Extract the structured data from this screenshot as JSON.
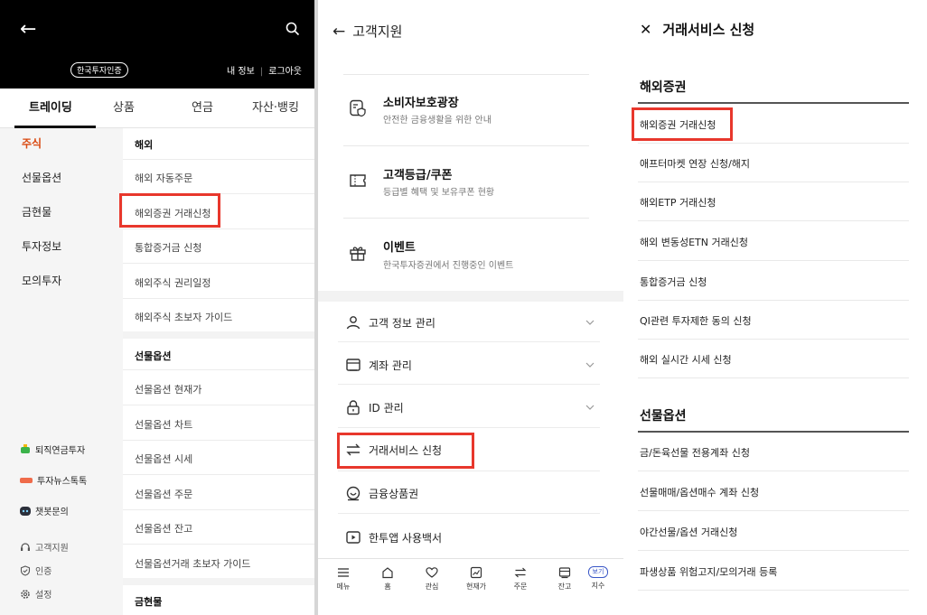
{
  "panel1": {
    "badge": "한국투자인증",
    "links": [
      "내 정보",
      "로그아웃"
    ],
    "tabs": [
      "트레이딩",
      "상품",
      "연금",
      "자산·뱅킹"
    ],
    "side_menu": [
      "주식",
      "선물옵션",
      "금현물",
      "투자정보",
      "모의투자"
    ],
    "side_extras": [
      "퇴직연금투자",
      "투자뉴스톡톡",
      "챗봇문의"
    ],
    "side_bottom": [
      "고객지원",
      "인증",
      "설정"
    ],
    "main": {
      "overseas_header": "해외",
      "overseas_items": [
        "해외 자동주문",
        "해외증권 거래신청",
        "통합증거금 신청",
        "해외주식 권리일정",
        "해외주식 초보자 가이드"
      ],
      "futures_header": "선물옵션",
      "futures_items": [
        "선물옵션 현재가",
        "선물옵션 차트",
        "선물옵션 시세",
        "선물옵션 주문",
        "선물옵션 잔고",
        "선물옵션거래 초보자 가이드"
      ],
      "gold_header": "금현물"
    }
  },
  "panel2": {
    "title": "고객지원",
    "cards": [
      {
        "title": "소비자보호광장",
        "sub": "안전한 금융생활을 위한 안내"
      },
      {
        "title": "고객등급/쿠폰",
        "sub": "등급별 혜택 및 보유쿠폰 현황"
      },
      {
        "title": "이벤트",
        "sub": "한국투자증권에서 진행중인 이벤트"
      }
    ],
    "rows": [
      "고객 정보 관리",
      "계좌 관리",
      "ID 관리",
      "거래서비스 신청",
      "금융상품권",
      "한투앱 사용백서"
    ],
    "nav": [
      "메뉴",
      "홈",
      "관심",
      "현재가",
      "주문",
      "잔고",
      "지수"
    ],
    "nav_badge": "보기"
  },
  "panel3": {
    "title": "거래서비스 신청",
    "sec1": "해외증권",
    "sec1_items": [
      "해외증권 거래신청",
      "애프터마켓 연장 신청/해지",
      "해외ETP 거래신청",
      "해외 변동성ETN 거래신청",
      "통합증거금 신청",
      "QI관련 투자제한 동의 신청",
      "해외 실시간 시세 신청"
    ],
    "sec2": "선물옵션",
    "sec2_items": [
      "금/돈육선물 전용계좌 신청",
      "선물매매/옵션매수 계좌 신청",
      "야간선물/옵션 거래신청",
      "파생상품 위험고지/모의거래 등록"
    ]
  },
  "colors": {
    "accent_red": "#e8372c",
    "active_orange": "#d9480f",
    "badge_blue": "#3a57c7"
  }
}
